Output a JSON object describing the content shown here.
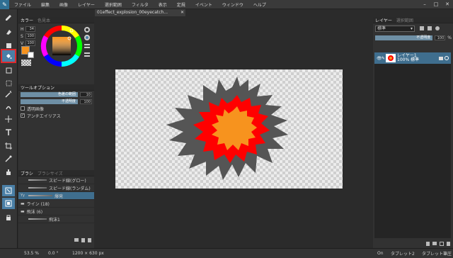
{
  "menubar": {
    "items": [
      "ファイル",
      "編集",
      "画像",
      "レイヤー",
      "選択範囲",
      "フィルタ",
      "表示",
      "定規",
      "イベント",
      "ウィンドウ",
      "ヘルプ"
    ],
    "win": [
      "–",
      "□",
      "✕"
    ]
  },
  "toolbar": {
    "tools": [
      "pen-icon",
      "eraser-icon",
      "square-icon",
      "fill-bucket-icon",
      "rect-select-icon",
      "dotted-select-icon",
      "magic-wand-icon",
      "mixer-icon",
      "move-icon",
      "text-icon",
      "crop-icon",
      "eyedropper-icon",
      "hand-icon",
      "zoom-icon",
      "swap-icon",
      "lock-icon"
    ],
    "highlighted_tool": "fill-bucket-icon"
  },
  "color_panel": {
    "tab_active": "カラー",
    "tab_inactive": "色見本",
    "h": "34",
    "s": "100",
    "v": "100",
    "h_label": "H",
    "s_label": "S",
    "v_label": "V",
    "foreground_color": "#f7931e"
  },
  "tool_options": {
    "title": "ツールオプション",
    "rows": [
      {
        "label": "色差の範囲",
        "value": "10"
      },
      {
        "label": "不透明度",
        "value": "100"
      }
    ],
    "checkboxes": [
      {
        "label": "透明画像",
        "checked": false
      },
      {
        "label": "アンチエイリアス",
        "checked": true
      }
    ]
  },
  "brush_panel": {
    "tab_active": "ブラシ",
    "tab_inactive": "ブラシサイズ",
    "items": [
      {
        "label": "スピード線(グロー)"
      },
      {
        "label": "スピード線(ランダム)"
      },
      {
        "label": "爆発"
      }
    ],
    "folders": [
      {
        "label": "ライン (18)"
      },
      {
        "label": "飛沫 (6)"
      }
    ],
    "sub_item": "飛沫1"
  },
  "canvas": {
    "file_tab": "01effect_explosion_00eyecatch...",
    "file_tab_close": "✕",
    "colors": {
      "smoke": "#555555",
      "red": "#ff0000",
      "orange": "#f7931e"
    }
  },
  "layer_panel": {
    "tab_active": "レイヤー",
    "tab_inactive": "選択範囲",
    "blend_mode": "標準",
    "opacity_label": "不透明度",
    "opacity": "100",
    "opacity_suffix": "%",
    "layer_name": "レイヤー1",
    "layer_info": "100% 標準"
  },
  "status": {
    "zoom": "53.5 %",
    "angle": "0.0 °",
    "size": "1200 × 630 px",
    "on_label": "On",
    "tablet": "タブレット2",
    "tablet_pressure": "タブレット筆圧"
  }
}
